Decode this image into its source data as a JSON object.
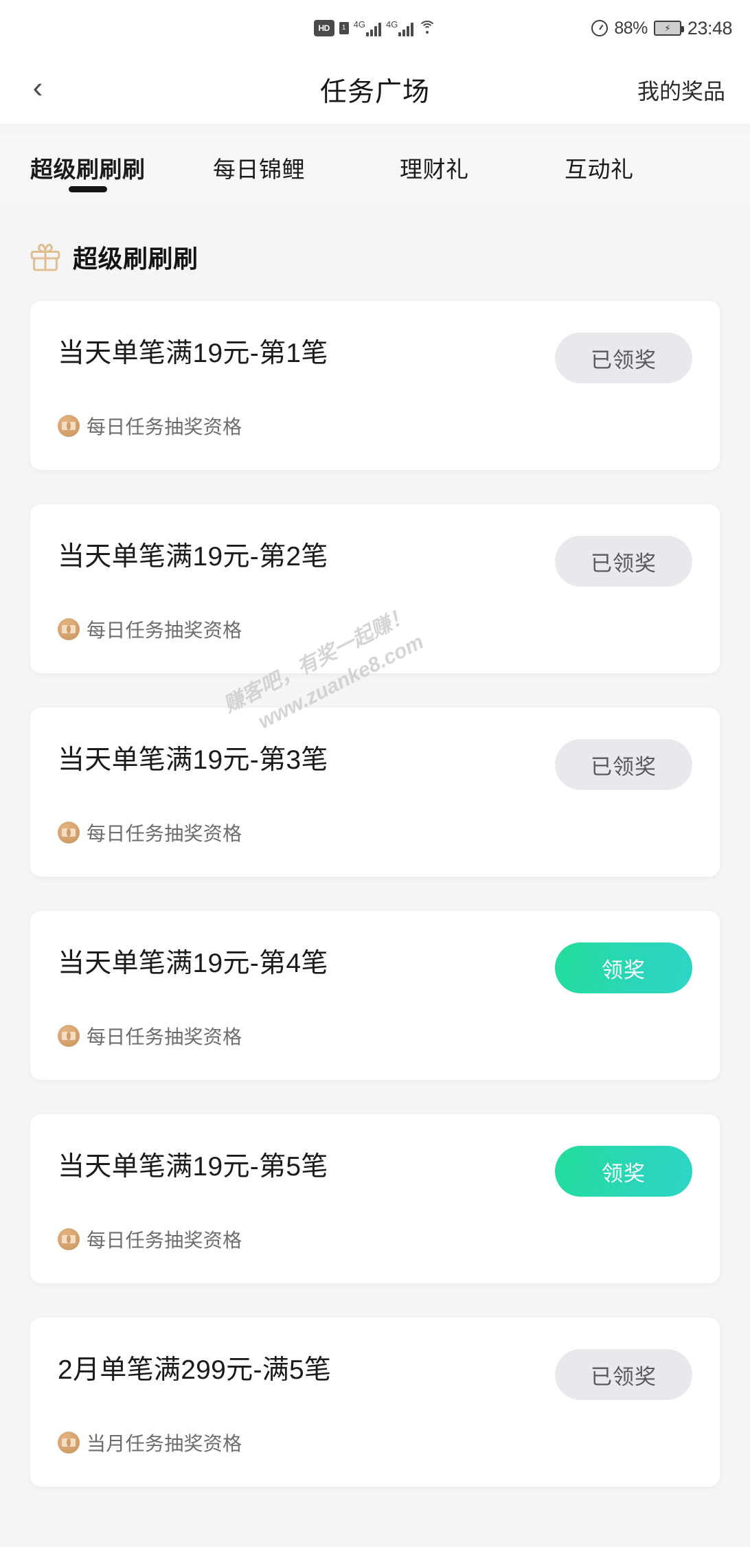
{
  "status_bar": {
    "hd_label": "HD",
    "sim_label": "1",
    "network_1": "4G",
    "network_2": "4G",
    "wifi_icon": "wifi-icon",
    "alarm_icon": "alarm-clock-icon",
    "battery_percent": "88%",
    "battery_icon": "battery-charging-icon",
    "time": "23:48"
  },
  "navbar": {
    "back_icon": "‹",
    "title": "任务广场",
    "action_label": "我的奖品"
  },
  "tabs": [
    {
      "label": "超级刷刷刷",
      "active": true
    },
    {
      "label": "每日锦鲤",
      "active": false
    },
    {
      "label": "理财礼",
      "active": false
    },
    {
      "label": "互动礼",
      "active": false
    }
  ],
  "section": {
    "icon": "gift-box-icon",
    "title": "超级刷刷刷"
  },
  "tasks": [
    {
      "title": "当天单笔满19元-第1笔",
      "reward": "每日任务抽奖资格",
      "button_label": "已领奖",
      "state": "claimed"
    },
    {
      "title": "当天单笔满19元-第2笔",
      "reward": "每日任务抽奖资格",
      "button_label": "已领奖",
      "state": "claimed"
    },
    {
      "title": "当天单笔满19元-第3笔",
      "reward": "每日任务抽奖资格",
      "button_label": "已领奖",
      "state": "claimed"
    },
    {
      "title": "当天单笔满19元-第4笔",
      "reward": "每日任务抽奖资格",
      "button_label": "领奖",
      "state": "active"
    },
    {
      "title": "当天单笔满19元-第5笔",
      "reward": "每日任务抽奖资格",
      "button_label": "领奖",
      "state": "active"
    },
    {
      "title": "2月单笔满299元-满5笔",
      "reward": "当月任务抽奖资格",
      "button_label": "已领奖",
      "state": "claimed"
    }
  ],
  "watermark": {
    "line1": "赚客吧，有奖一起赚！",
    "line2": "www.zuanke8.com"
  },
  "colors": {
    "page_background": "#f5f5f5",
    "card_background": "#ffffff",
    "accent_green_start": "#23dd9b",
    "accent_green_end": "#2ed5c6",
    "claimed_button_bg": "#e9e9ed",
    "claimed_button_text": "#58585e",
    "gift_icon": "#ddbf92",
    "coupon_dot": "#cf9d67",
    "tab_indicator": "#161616"
  }
}
